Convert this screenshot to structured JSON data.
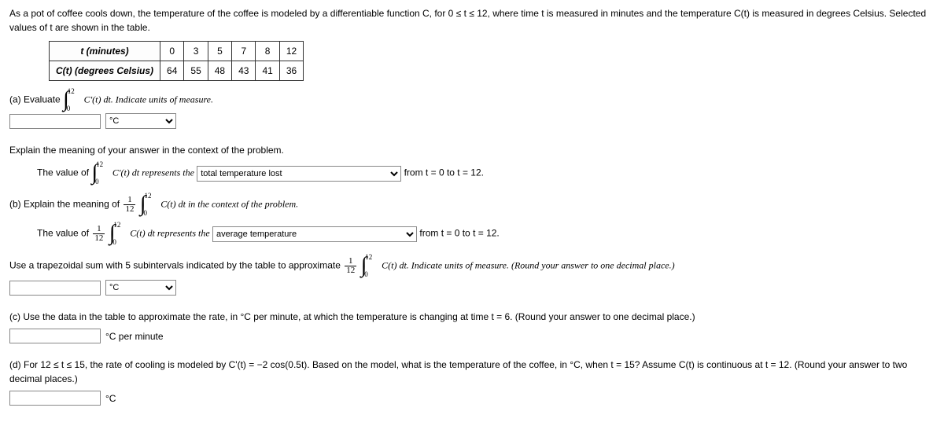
{
  "intro": "As a pot of coffee cools down, the temperature of the coffee is modeled by a differentiable function C, for 0 ≤ t ≤ 12, where time t is measured in minutes and the temperature C(t) is measured in degrees Celsius. Selected values of t are shown in the table.",
  "table": {
    "row1_label": "t (minutes)",
    "row1_vals": [
      "0",
      "3",
      "5",
      "7",
      "8",
      "12"
    ],
    "row2_label": "C(t) (degrees Celsius)",
    "row2_vals": [
      "64",
      "55",
      "48",
      "43",
      "41",
      "36"
    ]
  },
  "partA": {
    "prompt_prefix": "(a) Evaluate",
    "prompt_suffix": "C'(t) dt. Indicate units of measure.",
    "unit_selected": "°C",
    "explain_head": "Explain the meaning of your answer in the context of the problem.",
    "sentence_prefix": "The value of",
    "sentence_mid": "C'(t) dt represents the",
    "dropdown_selected": "total temperature lost",
    "sentence_suffix": "from t = 0 to t = 12."
  },
  "partB": {
    "prompt_prefix": "(b) Explain the meaning of",
    "prompt_suffix": "C(t) dt in the context of the problem.",
    "sentence_prefix": "The value of",
    "sentence_mid": "C(t) dt represents the",
    "dropdown_selected": "average temperature",
    "sentence_suffix": "from t = 0 to t = 12.",
    "trap_prefix": "Use a trapezoidal sum with 5 subintervals indicated by the table to approximate",
    "trap_suffix": "C(t) dt. Indicate units of measure. (Round your answer to one decimal place.)",
    "unit_selected": "°C"
  },
  "partC": {
    "prompt": "(c) Use the data in the table to approximate the rate, in °C per minute, at which the temperature is changing at time t = 6. (Round your answer to one decimal place.)",
    "unit_text": "°C per minute"
  },
  "partD": {
    "prompt": "(d) For 12 ≤ t ≤ 15, the rate of cooling is modeled by C'(t) = −2 cos(0.5t). Based on the model, what is the temperature of the coffee, in °C, when t = 15? Assume C(t) is continuous at t = 12. (Round your answer to two decimal places.)",
    "unit_text": "°C"
  },
  "integral": {
    "upper": "12",
    "lower": "0"
  },
  "frac": {
    "num": "1",
    "den": "12"
  },
  "chart_data": {
    "type": "table",
    "columns": [
      "t (minutes)",
      "C(t) (degrees Celsius)"
    ],
    "rows": [
      [
        0,
        64
      ],
      [
        3,
        55
      ],
      [
        5,
        48
      ],
      [
        7,
        43
      ],
      [
        8,
        41
      ],
      [
        12,
        36
      ]
    ]
  }
}
